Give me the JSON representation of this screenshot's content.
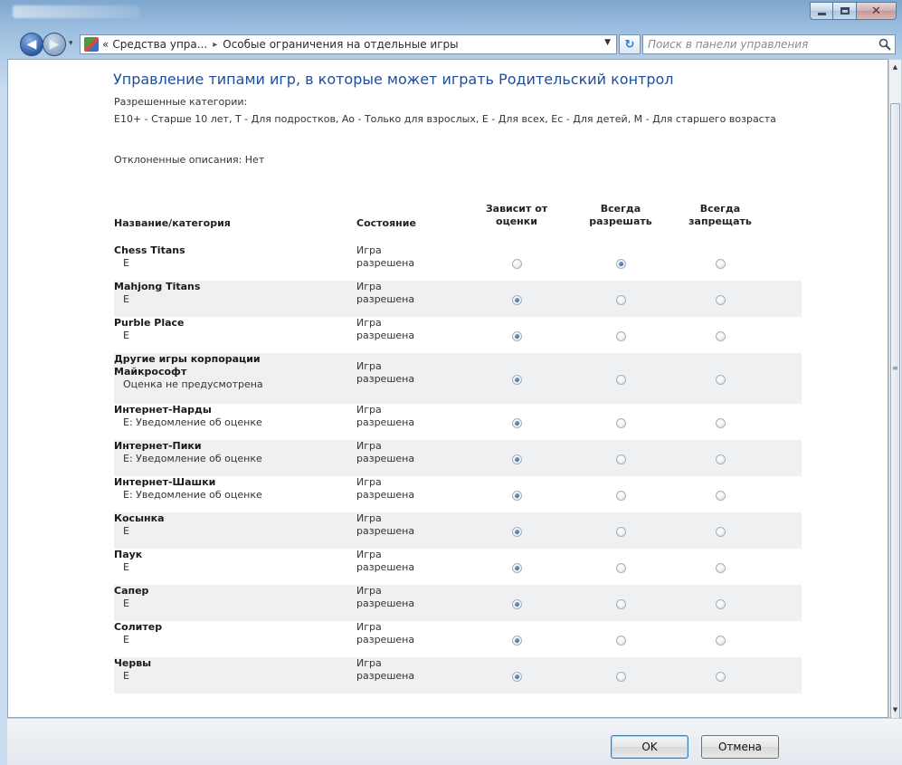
{
  "window": {
    "search_placeholder": "Поиск в панели управления"
  },
  "breadcrumb": {
    "prefix": "«",
    "parent": "Средства упра...",
    "separator": "▸",
    "current": "Особые ограничения на отдельные игры"
  },
  "page": {
    "title": "Управление типами игр, в которые может играть Родительский контрол",
    "allowed_label": "Разрешенные категории:",
    "allowed_text": "E10+ - Старше 10 лет, T - Для подростков, Ao - Только для взрослых, E - Для всех, Ec - Для детей, M - Для старшего возраста",
    "rejected": "Отклоненные описания:  Нет"
  },
  "table": {
    "headers": {
      "name": "Название/категория",
      "state": "Состояние",
      "by_rating": "Зависит от оценки",
      "always_allow": "Всегда разрешать",
      "always_block": "Всегда запрещать"
    },
    "rows": [
      {
        "name": "Chess Titans",
        "rating": "E",
        "state": "Игра разрешена",
        "selected": "always_allow"
      },
      {
        "name": "Mahjong Titans",
        "rating": "E",
        "state": "Игра разрешена",
        "selected": "by_rating"
      },
      {
        "name": "Purble Place",
        "rating": "E",
        "state": "Игра разрешена",
        "selected": "by_rating"
      },
      {
        "name": "Другие игры корпорации Майкрософт",
        "rating": "Оценка не предусмотрена",
        "state": "Игра разрешена",
        "selected": "by_rating"
      },
      {
        "name": "Интернет-Нарды",
        "rating": "E: Уведомление об оценке",
        "state": "Игра разрешена",
        "selected": "by_rating"
      },
      {
        "name": "Интернет-Пики",
        "rating": "E: Уведомление об оценке",
        "state": "Игра разрешена",
        "selected": "by_rating"
      },
      {
        "name": "Интернет-Шашки",
        "rating": "E: Уведомление об оценке",
        "state": "Игра разрешена",
        "selected": "by_rating"
      },
      {
        "name": "Косынка",
        "rating": "E",
        "state": "Игра разрешена",
        "selected": "by_rating"
      },
      {
        "name": "Паук",
        "rating": "E",
        "state": "Игра разрешена",
        "selected": "by_rating"
      },
      {
        "name": "Сапер",
        "rating": "E",
        "state": "Игра разрешена",
        "selected": "by_rating"
      },
      {
        "name": "Солитер",
        "rating": "E",
        "state": "Игра разрешена",
        "selected": "by_rating"
      },
      {
        "name": "Червы",
        "rating": "E",
        "state": "Игра разрешена",
        "selected": "by_rating"
      }
    ]
  },
  "buttons": {
    "ok": "OK",
    "cancel": "Отмена"
  },
  "colors": {
    "title": "#1e4e9a",
    "alt_row": "#eef0f2"
  }
}
